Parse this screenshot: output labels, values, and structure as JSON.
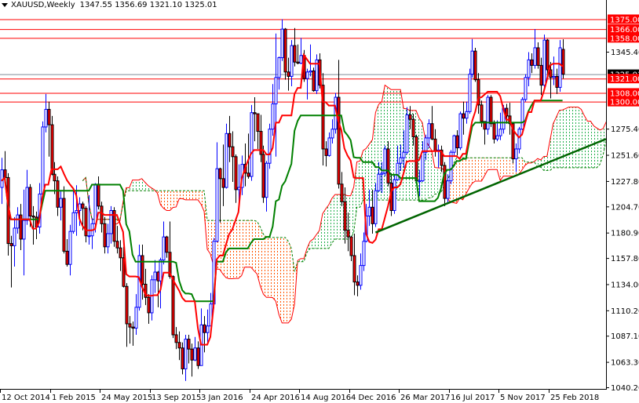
{
  "header": {
    "symbol": "XAUUSD,Weekly",
    "ohlc_text": "1347.55 1356.69 1321.10 1325.01"
  },
  "chart_data": {
    "type": "candlestick",
    "interval": "weekly",
    "ylim": [
      1040.2,
      1388
    ],
    "price_ticks": [
      "1345.40",
      "1275.40",
      "1251.60",
      "1227.80",
      "1204.70",
      "1180.90",
      "1157.80",
      "1134.00",
      "1110.20",
      "1087.10",
      "1063.30",
      "1040.20"
    ],
    "date_ticks": [
      {
        "date": "2014-10-12",
        "label": "12 Oct 2014"
      },
      {
        "date": "2015-02-01",
        "label": "1 Feb 2015"
      },
      {
        "date": "2015-05-24",
        "label": "24 May 2015"
      },
      {
        "date": "2015-09-13",
        "label": "13 Sep 2015"
      },
      {
        "date": "2016-01-03",
        "label": "3 Jan 2016"
      },
      {
        "date": "2016-04-24",
        "label": "24 Apr 2016"
      },
      {
        "date": "2016-08-14",
        "label": "14 Aug 2016"
      },
      {
        "date": "2016-12-04",
        "label": "4 Dec 2016"
      },
      {
        "date": "2017-03-26",
        "label": "26 Mar 2017"
      },
      {
        "date": "2017-07-16",
        "label": "16 Jul 2017"
      },
      {
        "date": "2017-11-05",
        "label": "5 Nov 2017"
      },
      {
        "date": "2018-02-25",
        "label": "25 Feb 2018"
      }
    ],
    "levels": [
      {
        "price": 1375.0,
        "label": "1375.00"
      },
      {
        "price": 1366.0,
        "label": "1366.00"
      },
      {
        "price": 1358.0,
        "label": "1358.00"
      },
      {
        "price": 1321.0,
        "label": "1321.00"
      },
      {
        "price": 1308.0,
        "label": "1308.00"
      },
      {
        "price": 1300.0,
        "label": "1300.00"
      }
    ],
    "current_price": {
      "price": 1325.01,
      "label": "1325.01"
    },
    "trendline": [
      [
        "2017-01-29",
        1181
      ],
      [
        "2018-03-25",
        1250
      ]
    ],
    "indicator": "Ichimoku Kinko Hyo",
    "colors": {
      "bull": "#0000ff",
      "bear_body": "#ff0000",
      "bear_wick": "#000000",
      "tenkan": "#ff0000",
      "kijun": "#008000",
      "level": "#ff0000",
      "current": "#7f8c99",
      "cloud_bull": "#22b04c",
      "cloud_bear": "#ff5500",
      "trendline": "#006400"
    },
    "candles": [
      [
        "2014-10-12",
        1222,
        1249,
        1207,
        1238
      ],
      [
        "2014-10-19",
        1238,
        1255,
        1224,
        1231
      ],
      [
        "2014-10-26",
        1231,
        1235,
        1160,
        1171
      ],
      [
        "2014-11-02",
        1171,
        1178,
        1131,
        1169
      ],
      [
        "2014-11-09",
        1169,
        1195,
        1150,
        1185
      ],
      [
        "2014-11-16",
        1185,
        1204,
        1180,
        1197
      ],
      [
        "2014-11-23",
        1197,
        1207,
        1165,
        1175
      ],
      [
        "2014-11-30",
        1175,
        1220,
        1142,
        1192
      ],
      [
        "2014-12-07",
        1192,
        1238,
        1188,
        1222
      ],
      [
        "2014-12-14",
        1222,
        1225,
        1186,
        1196
      ],
      [
        "2014-12-21",
        1196,
        1205,
        1170,
        1195
      ],
      [
        "2014-12-28",
        1195,
        1200,
        1175,
        1186
      ],
      [
        "2015-01-04",
        1186,
        1226,
        1180,
        1216
      ],
      [
        "2015-01-11",
        1216,
        1282,
        1214,
        1277
      ],
      [
        "2015-01-18",
        1277,
        1307,
        1272,
        1293
      ],
      [
        "2015-01-25",
        1293,
        1300,
        1250,
        1279
      ],
      [
        "2015-02-01",
        1279,
        1287,
        1233,
        1234
      ],
      [
        "2015-02-08",
        1234,
        1245,
        1216,
        1228
      ],
      [
        "2015-02-15",
        1228,
        1232,
        1196,
        1204
      ],
      [
        "2015-02-22",
        1204,
        1219,
        1192,
        1212
      ],
      [
        "2015-03-01",
        1212,
        1223,
        1162,
        1164
      ],
      [
        "2015-03-08",
        1164,
        1175,
        1150,
        1152
      ],
      [
        "2015-03-15",
        1152,
        1188,
        1142,
        1182
      ],
      [
        "2015-03-22",
        1182,
        1219,
        1180,
        1199
      ],
      [
        "2015-03-29",
        1199,
        1224,
        1178,
        1201
      ],
      [
        "2015-04-05",
        1201,
        1213,
        1187,
        1207
      ],
      [
        "2015-04-12",
        1207,
        1209,
        1183,
        1203
      ],
      [
        "2015-04-19",
        1203,
        1205,
        1172,
        1178
      ],
      [
        "2015-04-26",
        1178,
        1215,
        1170,
        1178
      ],
      [
        "2015-05-03",
        1178,
        1194,
        1166,
        1189
      ],
      [
        "2015-05-10",
        1189,
        1226,
        1181,
        1225
      ],
      [
        "2015-05-17",
        1225,
        1232,
        1202,
        1205
      ],
      [
        "2015-05-24",
        1205,
        1209,
        1181,
        1189
      ],
      [
        "2015-05-31",
        1189,
        1195,
        1162,
        1168
      ],
      [
        "2015-06-07",
        1168,
        1189,
        1162,
        1180
      ],
      [
        "2015-06-14",
        1180,
        1205,
        1171,
        1201
      ],
      [
        "2015-06-21",
        1201,
        1204,
        1168,
        1173
      ],
      [
        "2015-06-28",
        1173,
        1187,
        1162,
        1167
      ],
      [
        "2015-07-05",
        1167,
        1174,
        1146,
        1158
      ],
      [
        "2015-07-12",
        1158,
        1168,
        1131,
        1132
      ],
      [
        "2015-07-19",
        1132,
        1135,
        1077,
        1098
      ],
      [
        "2015-07-26",
        1098,
        1105,
        1080,
        1095
      ],
      [
        "2015-08-02",
        1095,
        1100,
        1078,
        1094
      ],
      [
        "2015-08-09",
        1094,
        1125,
        1088,
        1113
      ],
      [
        "2015-08-16",
        1113,
        1170,
        1110,
        1160
      ],
      [
        "2015-08-23",
        1160,
        1170,
        1120,
        1134
      ],
      [
        "2015-08-30",
        1134,
        1148,
        1115,
        1122
      ],
      [
        "2015-09-06",
        1122,
        1125,
        1098,
        1108
      ],
      [
        "2015-09-13",
        1108,
        1142,
        1101,
        1138
      ],
      [
        "2015-09-20",
        1138,
        1156,
        1126,
        1145
      ],
      [
        "2015-09-27",
        1145,
        1146,
        1113,
        1137
      ],
      [
        "2015-10-04",
        1137,
        1158,
        1112,
        1156
      ],
      [
        "2015-10-11",
        1156,
        1191,
        1152,
        1177
      ],
      [
        "2015-10-18",
        1177,
        1178,
        1158,
        1163
      ],
      [
        "2015-10-25",
        1163,
        1191,
        1139,
        1141
      ],
      [
        "2015-11-01",
        1141,
        1142,
        1085,
        1088
      ],
      [
        "2015-11-08",
        1088,
        1095,
        1075,
        1081
      ],
      [
        "2015-11-15",
        1081,
        1091,
        1065,
        1076
      ],
      [
        "2015-11-22",
        1076,
        1081,
        1052,
        1057
      ],
      [
        "2015-11-29",
        1057,
        1088,
        1046,
        1084
      ],
      [
        "2015-12-06",
        1084,
        1088,
        1062,
        1075
      ],
      [
        "2015-12-13",
        1075,
        1080,
        1050,
        1065
      ],
      [
        "2015-12-20",
        1065,
        1086,
        1064,
        1076
      ],
      [
        "2015-12-27",
        1076,
        1082,
        1057,
        1060
      ],
      [
        "2016-01-03",
        1060,
        1112,
        1060,
        1097
      ],
      [
        "2016-01-10",
        1097,
        1105,
        1072,
        1090
      ],
      [
        "2016-01-17",
        1090,
        1111,
        1080,
        1096
      ],
      [
        "2016-01-24",
        1096,
        1126,
        1096,
        1116
      ],
      [
        "2016-01-31",
        1116,
        1176,
        1112,
        1173
      ],
      [
        "2016-02-07",
        1173,
        1263,
        1172,
        1239
      ],
      [
        "2016-02-14",
        1239,
        1240,
        1190,
        1230
      ],
      [
        "2016-02-21",
        1230,
        1261,
        1205,
        1222
      ],
      [
        "2016-02-28",
        1222,
        1280,
        1221,
        1271
      ],
      [
        "2016-03-06",
        1271,
        1287,
        1245,
        1259
      ],
      [
        "2016-03-13",
        1259,
        1273,
        1227,
        1250
      ],
      [
        "2016-03-20",
        1250,
        1252,
        1208,
        1220
      ],
      [
        "2016-03-27",
        1220,
        1243,
        1208,
        1222
      ],
      [
        "2016-04-03",
        1222,
        1251,
        1215,
        1243
      ],
      [
        "2016-04-10",
        1243,
        1262,
        1223,
        1235
      ],
      [
        "2016-04-17",
        1235,
        1271,
        1230,
        1232
      ],
      [
        "2016-04-24",
        1232,
        1297,
        1228,
        1290
      ],
      [
        "2016-05-01",
        1290,
        1304,
        1264,
        1289
      ],
      [
        "2016-05-08",
        1289,
        1289,
        1257,
        1273
      ],
      [
        "2016-05-15",
        1273,
        1288,
        1245,
        1252
      ],
      [
        "2016-05-22",
        1252,
        1260,
        1208,
        1213
      ],
      [
        "2016-05-29",
        1213,
        1246,
        1200,
        1244
      ],
      [
        "2016-06-05",
        1244,
        1280,
        1239,
        1275
      ],
      [
        "2016-06-12",
        1275,
        1316,
        1269,
        1298
      ],
      [
        "2016-06-19",
        1298,
        1362,
        1250,
        1322
      ],
      [
        "2016-06-26",
        1322,
        1341,
        1311,
        1340
      ],
      [
        "2016-07-03",
        1340,
        1375,
        1337,
        1366
      ],
      [
        "2016-07-10",
        1366,
        1367,
        1320,
        1327
      ],
      [
        "2016-07-17",
        1327,
        1340,
        1310,
        1323
      ],
      [
        "2016-07-24",
        1323,
        1356,
        1314,
        1351
      ],
      [
        "2016-07-31",
        1351,
        1367,
        1332,
        1336
      ],
      [
        "2016-08-07",
        1336,
        1352,
        1334,
        1335
      ],
      [
        "2016-08-14",
        1335,
        1358,
        1334,
        1342
      ],
      [
        "2016-08-21",
        1342,
        1347,
        1318,
        1321
      ],
      [
        "2016-08-28",
        1321,
        1330,
        1302,
        1327
      ],
      [
        "2016-09-04",
        1327,
        1352,
        1323,
        1328
      ],
      [
        "2016-09-11",
        1328,
        1331,
        1309,
        1310
      ],
      [
        "2016-09-18",
        1310,
        1343,
        1307,
        1338
      ],
      [
        "2016-09-25",
        1338,
        1344,
        1312,
        1315
      ],
      [
        "2016-10-02",
        1315,
        1326,
        1242,
        1257
      ],
      [
        "2016-10-09",
        1257,
        1264,
        1241,
        1251
      ],
      [
        "2016-10-16",
        1251,
        1272,
        1250,
        1267
      ],
      [
        "2016-10-23",
        1267,
        1284,
        1262,
        1275
      ],
      [
        "2016-10-30",
        1275,
        1308,
        1271,
        1304
      ],
      [
        "2016-11-06",
        1304,
        1338,
        1221,
        1225
      ],
      [
        "2016-11-13",
        1225,
        1236,
        1205,
        1209
      ],
      [
        "2016-11-20",
        1209,
        1222,
        1171,
        1183
      ],
      [
        "2016-11-27",
        1183,
        1199,
        1164,
        1177
      ],
      [
        "2016-12-04",
        1177,
        1178,
        1155,
        1160
      ],
      [
        "2016-12-11",
        1160,
        1180,
        1124,
        1136
      ],
      [
        "2016-12-18",
        1136,
        1142,
        1123,
        1133
      ],
      [
        "2016-12-25",
        1133,
        1162,
        1129,
        1151
      ],
      [
        "2017-01-01",
        1151,
        1181,
        1146,
        1173
      ],
      [
        "2017-01-08",
        1173,
        1207,
        1172,
        1196
      ],
      [
        "2017-01-15",
        1196,
        1220,
        1187,
        1204
      ],
      [
        "2017-01-22",
        1204,
        1220,
        1180,
        1189
      ],
      [
        "2017-01-29",
        1189,
        1226,
        1186,
        1219
      ],
      [
        "2017-02-05",
        1219,
        1245,
        1218,
        1234
      ],
      [
        "2017-02-12",
        1234,
        1245,
        1217,
        1235
      ],
      [
        "2017-02-19",
        1235,
        1260,
        1232,
        1257
      ],
      [
        "2017-02-26",
        1257,
        1264,
        1223,
        1226
      ],
      [
        "2017-03-05",
        1226,
        1235,
        1196,
        1201
      ],
      [
        "2017-03-12",
        1201,
        1233,
        1198,
        1229
      ],
      [
        "2017-03-19",
        1229,
        1260,
        1228,
        1244
      ],
      [
        "2017-03-26",
        1244,
        1261,
        1237,
        1249
      ],
      [
        "2017-04-02",
        1249,
        1274,
        1240,
        1254
      ],
      [
        "2017-04-09",
        1254,
        1295,
        1252,
        1288
      ],
      [
        "2017-04-16",
        1288,
        1296,
        1275,
        1284
      ],
      [
        "2017-04-23",
        1284,
        1289,
        1260,
        1268
      ],
      [
        "2017-04-30",
        1268,
        1270,
        1226,
        1228
      ],
      [
        "2017-05-07",
        1228,
        1238,
        1214,
        1228
      ],
      [
        "2017-05-14",
        1228,
        1264,
        1227,
        1254
      ],
      [
        "2017-05-21",
        1254,
        1270,
        1247,
        1267
      ],
      [
        "2017-05-28",
        1267,
        1284,
        1258,
        1280
      ],
      [
        "2017-06-04",
        1280,
        1296,
        1265,
        1266
      ],
      [
        "2017-06-11",
        1266,
        1275,
        1250,
        1255
      ],
      [
        "2017-06-18",
        1255,
        1261,
        1240,
        1256
      ],
      [
        "2017-06-25",
        1256,
        1260,
        1236,
        1242
      ],
      [
        "2017-07-02",
        1242,
        1245,
        1205,
        1212
      ],
      [
        "2017-07-09",
        1212,
        1234,
        1208,
        1228
      ],
      [
        "2017-07-16",
        1228,
        1256,
        1225,
        1254
      ],
      [
        "2017-07-23",
        1254,
        1270,
        1250,
        1269
      ],
      [
        "2017-07-30",
        1269,
        1274,
        1251,
        1258
      ],
      [
        "2017-08-06",
        1258,
        1291,
        1256,
        1289
      ],
      [
        "2017-08-13",
        1289,
        1300,
        1270,
        1285
      ],
      [
        "2017-08-20",
        1285,
        1300,
        1280,
        1291
      ],
      [
        "2017-08-27",
        1291,
        1330,
        1289,
        1325
      ],
      [
        "2017-09-03",
        1325,
        1357,
        1322,
        1346
      ],
      [
        "2017-09-10",
        1346,
        1349,
        1318,
        1320
      ],
      [
        "2017-09-17",
        1320,
        1326,
        1289,
        1297
      ],
      [
        "2017-09-24",
        1297,
        1301,
        1277,
        1282
      ],
      [
        "2017-10-01",
        1282,
        1282,
        1261,
        1275
      ],
      [
        "2017-10-08",
        1275,
        1306,
        1270,
        1304
      ],
      [
        "2017-10-15",
        1304,
        1306,
        1277,
        1280
      ],
      [
        "2017-10-22",
        1280,
        1283,
        1262,
        1266
      ],
      [
        "2017-10-29",
        1266,
        1283,
        1264,
        1269
      ],
      [
        "2017-11-05",
        1269,
        1290,
        1265,
        1275
      ],
      [
        "2017-11-12",
        1275,
        1297,
        1271,
        1294
      ],
      [
        "2017-11-19",
        1294,
        1298,
        1280,
        1287
      ],
      [
        "2017-11-26",
        1287,
        1299,
        1270,
        1280
      ],
      [
        "2017-12-03",
        1280,
        1281,
        1244,
        1248
      ],
      [
        "2017-12-10",
        1248,
        1262,
        1236,
        1257
      ],
      [
        "2017-12-17",
        1257,
        1277,
        1253,
        1275
      ],
      [
        "2017-12-24",
        1275,
        1304,
        1274,
        1302
      ],
      [
        "2017-12-31",
        1302,
        1325,
        1300,
        1322
      ],
      [
        "2018-01-07",
        1322,
        1345,
        1314,
        1338
      ],
      [
        "2018-01-14",
        1338,
        1344,
        1326,
        1333
      ],
      [
        "2018-01-21",
        1333,
        1366,
        1330,
        1349
      ],
      [
        "2018-01-28",
        1349,
        1354,
        1330,
        1333
      ],
      [
        "2018-02-04",
        1333,
        1340,
        1306,
        1315
      ],
      [
        "2018-02-11",
        1315,
        1361,
        1311,
        1356
      ],
      [
        "2018-02-18",
        1356,
        1357,
        1324,
        1329
      ],
      [
        "2018-02-25",
        1329,
        1336,
        1303,
        1322
      ],
      [
        "2018-03-04",
        1322,
        1341,
        1315,
        1323
      ],
      [
        "2018-03-11",
        1323,
        1330,
        1307,
        1313
      ],
      [
        "2018-03-18",
        1313,
        1356,
        1309,
        1349
      ],
      [
        "2018-03-25",
        1347.55,
        1356.69,
        1321.1,
        1325.01
      ]
    ]
  }
}
